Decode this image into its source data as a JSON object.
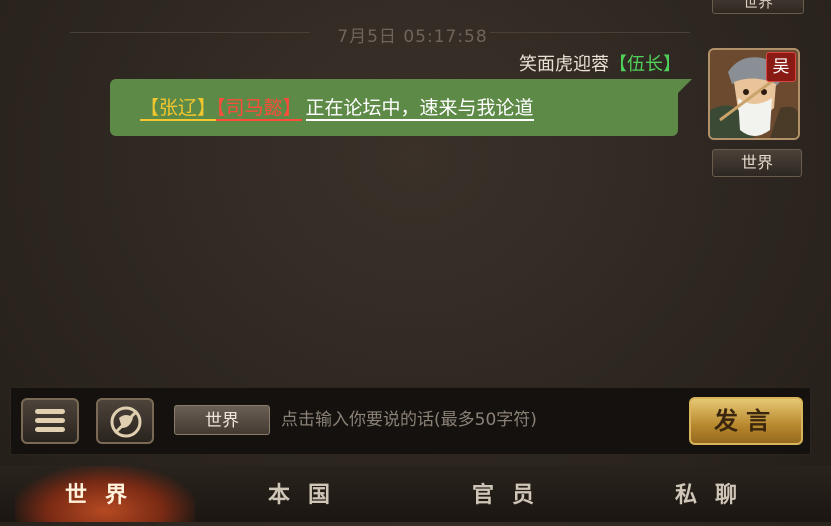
{
  "header": {
    "partial_channel_tag": "世界"
  },
  "chat": {
    "timestamp": "7月5日 05:17:58",
    "messages": [
      {
        "sender_name": "笑面虎迎蓉",
        "sender_rank": "【伍长】",
        "avatar_faction": "吴",
        "channel_tag": "世界",
        "segments": {
          "name1": "【张辽】",
          "name2": "【司马懿】",
          "text": "正在论坛中，速来与我论道"
        }
      }
    ]
  },
  "input_bar": {
    "channel_select": "世界",
    "placeholder": "点击输入你要说的话(最多50字符)",
    "send_label": "发言"
  },
  "tabs": [
    {
      "label": "世界",
      "active": true
    },
    {
      "label": "本国",
      "active": false
    },
    {
      "label": "官员",
      "active": false
    },
    {
      "label": "私聊",
      "active": false
    }
  ],
  "colors": {
    "bubble": "#5e8a48",
    "rank_green": "#4fd05a",
    "name_yellow": "#f2c62e",
    "name_red": "#ff4b3a",
    "send_gold": "#d9b45a"
  }
}
